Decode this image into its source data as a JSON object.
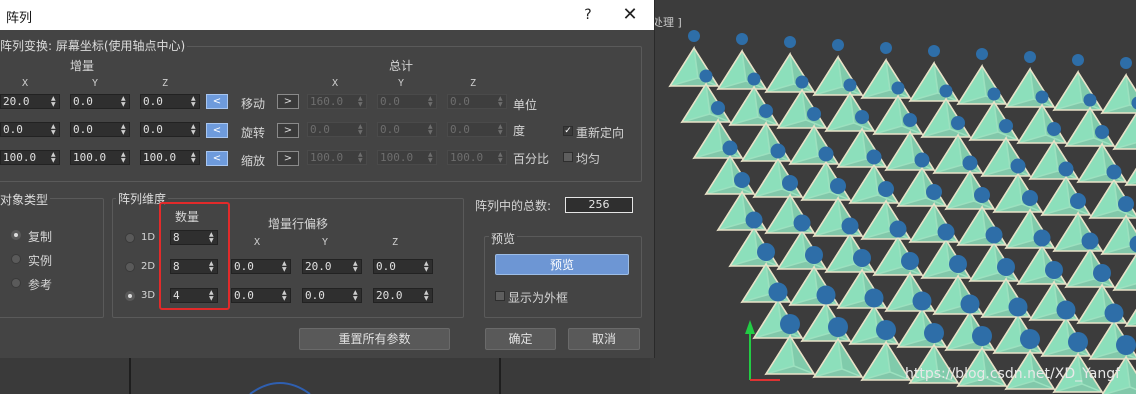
{
  "dialog": {
    "title": "阵列",
    "help_glyph": "?",
    "close_glyph": "✕"
  },
  "viewport": {
    "label": "处理 ]",
    "watermark": "https://blog.csdn.net/XD_Yangf"
  },
  "transform": {
    "group_title": "阵列变换: 屏幕坐标(使用轴点中心)",
    "increment_header": "增量",
    "totals_header": "总计",
    "axis_x": "X",
    "axis_y": "Y",
    "axis_z": "Z",
    "rows": [
      {
        "op": "移动",
        "unit": "单位",
        "inc": [
          "20.0",
          "0.0",
          "0.0"
        ],
        "tot": [
          "160.0",
          "0.0",
          "0.0"
        ]
      },
      {
        "op": "旋转",
        "unit": "度",
        "inc": [
          "0.0",
          "0.0",
          "0.0"
        ],
        "tot": [
          "0.0",
          "0.0",
          "0.0"
        ]
      },
      {
        "op": "缩放",
        "unit": "百分比",
        "inc": [
          "100.0",
          "100.0",
          "100.0"
        ],
        "tot": [
          "100.0",
          "100.0",
          "100.0"
        ]
      }
    ],
    "reorient_label": "重新定向",
    "reorient_checked": true,
    "uniform_label": "均匀",
    "uniform_checked": false
  },
  "object_type": {
    "group_title": "对象类型",
    "options": [
      "复制",
      "实例",
      "参考"
    ],
    "selected": "复制"
  },
  "dimensions": {
    "group_title": "阵列维度",
    "count_header": "数量",
    "offset_header": "增量行偏移",
    "axis_x": "X",
    "axis_y": "Y",
    "axis_z": "Z",
    "rows": [
      {
        "label": "1D",
        "count": "8",
        "offsets": []
      },
      {
        "label": "2D",
        "count": "8",
        "offsets": [
          "0.0",
          "20.0",
          "0.0"
        ]
      },
      {
        "label": "3D",
        "count": "4",
        "offsets": [
          "0.0",
          "0.0",
          "20.0"
        ]
      }
    ],
    "selected": "3D"
  },
  "total": {
    "label": "阵列中的总数:",
    "value": "256"
  },
  "preview": {
    "group_title": "预览",
    "button": "预览",
    "bbox_label": "显示为外框",
    "bbox_checked": false
  },
  "footer": {
    "reset": "重置所有参数",
    "ok": "确定",
    "cancel": "取消"
  }
}
